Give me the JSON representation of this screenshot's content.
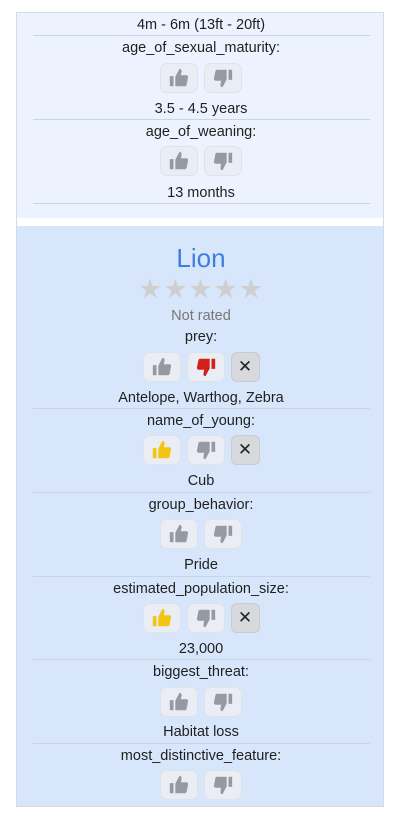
{
  "colors": {
    "accent": "#3b7fe0",
    "thumb_neutral": "#959aa2",
    "thumb_up_active": "#f2c513",
    "thumb_down_active": "#d0201c",
    "card_prev_bg": "#edf3fe",
    "card_current_bg": "#d7e6fb"
  },
  "previous_card": {
    "top_value": "4m - 6m (13ft - 20ft)",
    "fields": [
      {
        "key": "age_of_sexual_maturity:",
        "value": "3.5 - 4.5 years",
        "vote": "none"
      },
      {
        "key": "age_of_weaning:",
        "value": "13 months",
        "vote": "none"
      }
    ]
  },
  "animal_card": {
    "name": "Lion",
    "stars": "★★★★★",
    "rating_text": "Not rated",
    "fields": [
      {
        "key": "prey:",
        "value": "Antelope, Warthog, Zebra",
        "vote": "down"
      },
      {
        "key": "name_of_young:",
        "value": "Cub",
        "vote": "up"
      },
      {
        "key": "group_behavior:",
        "value": "Pride",
        "vote": "none"
      },
      {
        "key": "estimated_population_size:",
        "value": "23,000",
        "vote": "up"
      },
      {
        "key": "biggest_threat:",
        "value": "Habitat loss",
        "vote": "none"
      },
      {
        "key": "most_distinctive_feature:",
        "value": "",
        "vote": "none"
      }
    ],
    "clear_symbol": "✕"
  }
}
